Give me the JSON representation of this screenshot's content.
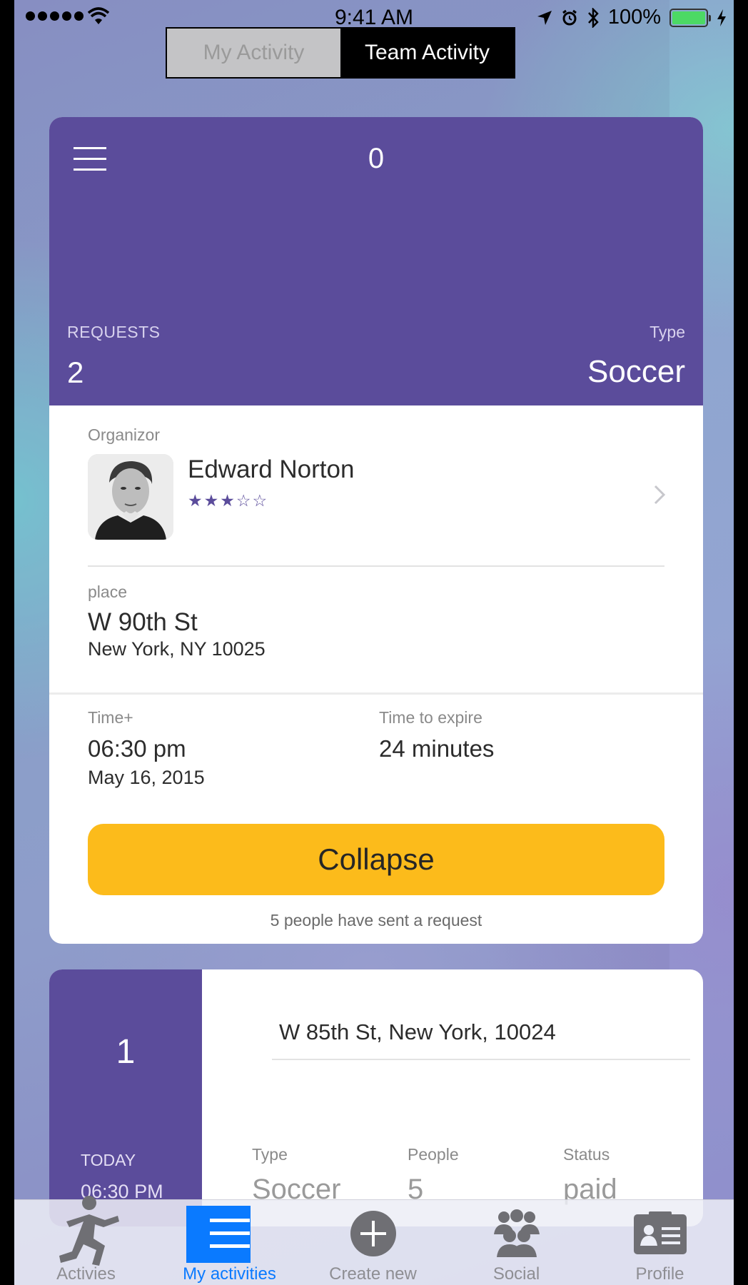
{
  "status_bar": {
    "time": "9:41 AM",
    "battery": "100%",
    "battery_color": "#4cd964"
  },
  "segmented": {
    "tabs": [
      {
        "label": "My Activity",
        "selected": false
      },
      {
        "label": "Team Activity",
        "selected": true
      }
    ]
  },
  "card1": {
    "accent": "#5b4c9b",
    "head_count": "0",
    "requests_label": "REQUESTS",
    "requests_value": "2",
    "type_label": "Type",
    "type_value": "Soccer",
    "organizer_label": "Organizor",
    "organizer_name": "Edward Norton",
    "rating_stars": "★★★☆☆",
    "rating_value": 3.5,
    "place_label": "place",
    "place_line1": "W 90th St",
    "place_line2": "New York, NY 10025",
    "time_label": "Time+",
    "time_value": "06:30 pm",
    "date_value": "May 16, 2015",
    "expire_label": "Time to expire",
    "expire_value": "24 minutes",
    "collapse_label": "Collapse",
    "collapse_color": "#fcbb1b",
    "request_note": "5 people have sent a request"
  },
  "card2": {
    "number": "1",
    "day": "TODAY",
    "time": "06:30 PM",
    "address": "W 85th St, New York, 10024",
    "type_label": "Type",
    "type_value": "Soccer",
    "people_label": "People",
    "people_value": "5",
    "status_label": "Status",
    "status_value": "paid"
  },
  "tabbar": {
    "active_color": "#0a7aff",
    "items": [
      {
        "label": "Activies",
        "icon": "runner-icon"
      },
      {
        "label": "My activities",
        "icon": "list-icon",
        "active": true
      },
      {
        "label": "Create new",
        "icon": "plus-circle-icon"
      },
      {
        "label": "Social",
        "icon": "group-icon"
      },
      {
        "label": "Profile",
        "icon": "id-card-icon"
      }
    ]
  }
}
